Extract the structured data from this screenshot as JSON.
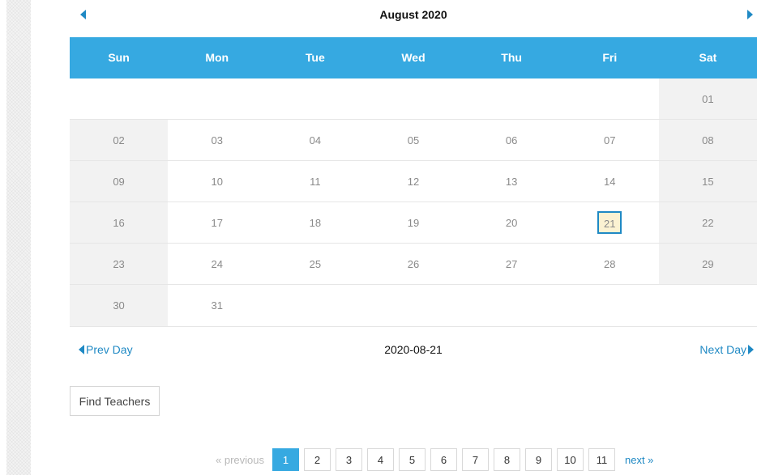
{
  "calendar": {
    "month_title": "August 2020",
    "weekdays": [
      "Sun",
      "Mon",
      "Tue",
      "Wed",
      "Thu",
      "Fri",
      "Sat"
    ],
    "weeks": [
      [
        "",
        "",
        "",
        "",
        "",
        "",
        "01"
      ],
      [
        "02",
        "03",
        "04",
        "05",
        "06",
        "07",
        "08"
      ],
      [
        "09",
        "10",
        "11",
        "12",
        "13",
        "14",
        "15"
      ],
      [
        "16",
        "17",
        "18",
        "19",
        "20",
        "21",
        "22"
      ],
      [
        "23",
        "24",
        "25",
        "26",
        "27",
        "28",
        "29"
      ],
      [
        "30",
        "31",
        "",
        "",
        "",
        "",
        ""
      ]
    ],
    "selected_day": "21"
  },
  "day_nav": {
    "prev_label": "Prev Day",
    "current_date": "2020-08-21",
    "next_label": "Next Day"
  },
  "find_button": "Find Teachers",
  "pagination": {
    "previous_label": "« previous",
    "pages": [
      "1",
      "2",
      "3",
      "4",
      "5",
      "6",
      "7",
      "8",
      "9",
      "10",
      "11"
    ],
    "active_page": "1",
    "next_label": "next »"
  },
  "colors": {
    "header_bg": "#36a9e1",
    "link": "#1f89c4",
    "today_bg": "#fbf2d2"
  }
}
